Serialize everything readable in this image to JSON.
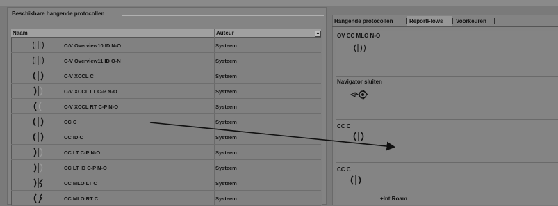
{
  "left_panel": {
    "title": "Beschikbare hangende protocollen",
    "columns": {
      "naam": "Naam",
      "auteur": "Auteur"
    },
    "rows": [
      {
        "naam": "C-V Overview10 ID N-O",
        "auteur": "Systeem",
        "icon": "double-breast-pair-icon"
      },
      {
        "naam": "C-V Overview11 ID O-N",
        "auteur": "Systeem",
        "icon": "double-breast-pair-icon"
      },
      {
        "naam": "C-V XCCL C",
        "auteur": "Systeem",
        "icon": "breast-pair-divider-icon"
      },
      {
        "naam": "C-V XCCL LT C-P N-O",
        "auteur": "Systeem",
        "icon": "breast-pair-left-icon"
      },
      {
        "naam": "C-V XCCL RT C-P N-O",
        "auteur": "Systeem",
        "icon": "breast-pair-right-icon"
      },
      {
        "naam": "CC C",
        "auteur": "Systeem",
        "icon": "breast-pair-icon"
      },
      {
        "naam": "CC ID C",
        "auteur": "Systeem",
        "icon": "breast-pair-divider-icon"
      },
      {
        "naam": "CC LT C-P N-O",
        "auteur": "Systeem",
        "icon": "breast-pair-left-icon"
      },
      {
        "naam": "CC LT ID C-P N-O",
        "auteur": "Systeem",
        "icon": "breast-pair-left-icon"
      },
      {
        "naam": "CC MLO LT C",
        "auteur": "Systeem",
        "icon": "breast-mlo-left-icon"
      },
      {
        "naam": "CC MLO RT C",
        "auteur": "Systeem",
        "icon": "breast-mlo-right-icon"
      }
    ]
  },
  "right_panel": {
    "tabs": [
      {
        "label": "Hangende protocollen",
        "active": false
      },
      {
        "label": "ReportFlows",
        "active": true
      },
      {
        "label": "Voorkeuren",
        "active": false
      }
    ],
    "flow_items": [
      {
        "title": "OV CC MLO N-O",
        "icon": "double-breast-pair-icon"
      },
      {
        "title": "Navigator sluiten",
        "icon": "navigator-close-icon"
      },
      {
        "title": "CC C",
        "icon": "breast-pair-icon"
      },
      {
        "title": "CC C",
        "icon": "breast-pair-icon",
        "sub": "+Int Roam"
      }
    ]
  },
  "colors": {
    "background": "#7a7a7a",
    "panel": "#848484",
    "header": "#a0a0a0",
    "text": "#111111"
  }
}
